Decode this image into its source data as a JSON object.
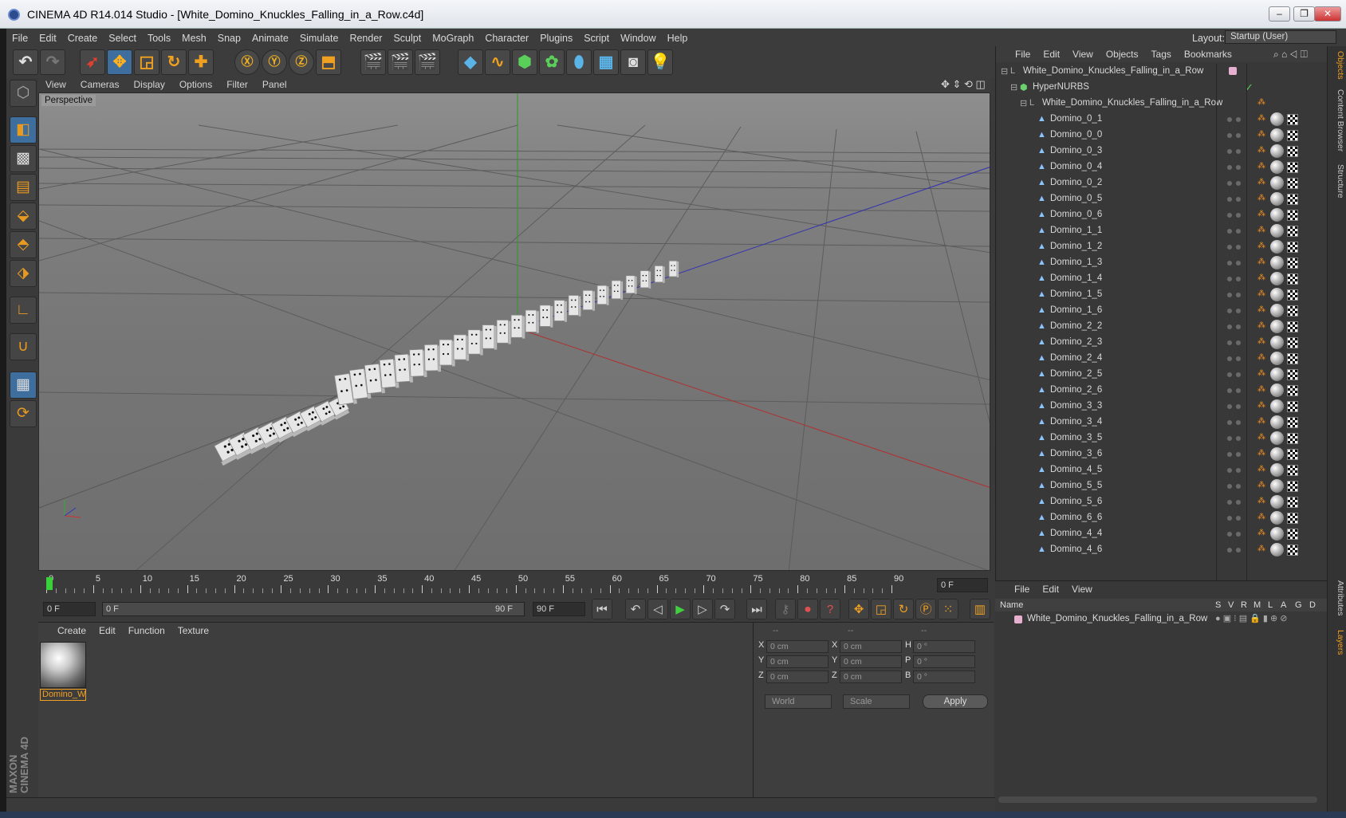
{
  "window": {
    "title": "CINEMA 4D R14.014 Studio - [White_Domino_Knuckles_Falling_in_a_Row.c4d]",
    "min": "–",
    "max": "❐",
    "close": "✕"
  },
  "menu": [
    "File",
    "Edit",
    "Create",
    "Select",
    "Tools",
    "Mesh",
    "Snap",
    "Animate",
    "Simulate",
    "Render",
    "Sculpt",
    "MoGraph",
    "Character",
    "Plugins",
    "Script",
    "Window",
    "Help"
  ],
  "layout": {
    "label": "Layout:",
    "value": "Startup (User)"
  },
  "viewport": {
    "menu": [
      "View",
      "Cameras",
      "Display",
      "Options",
      "Filter",
      "Panel"
    ],
    "label": "Perspective"
  },
  "objects": {
    "menu": [
      "File",
      "Edit",
      "View",
      "Objects",
      "Tags",
      "Bookmarks"
    ],
    "root": "White_Domino_Knuckles_Falling_in_a_Row",
    "hypernurbs": "HyperNURBS",
    "child": "White_Domino_Knuckles_Falling_in_a_Row",
    "items": [
      "Domino_0_1",
      "Domino_0_0",
      "Domino_0_3",
      "Domino_0_4",
      "Domino_0_2",
      "Domino_0_5",
      "Domino_0_6",
      "Domino_1_1",
      "Domino_1_2",
      "Domino_1_3",
      "Domino_1_4",
      "Domino_1_5",
      "Domino_1_6",
      "Domino_2_2",
      "Domino_2_3",
      "Domino_2_4",
      "Domino_2_5",
      "Domino_2_6",
      "Domino_3_3",
      "Domino_3_4",
      "Domino_3_5",
      "Domino_3_6",
      "Domino_4_5",
      "Domino_5_5",
      "Domino_5_6",
      "Domino_6_6",
      "Domino_4_4",
      "Domino_4_6"
    ]
  },
  "right_tabs": [
    "Objects",
    "Content Browser",
    "Structure",
    "Attributes",
    "Layers"
  ],
  "timeline": {
    "labels": [
      "0",
      "5",
      "10",
      "15",
      "20",
      "25",
      "30",
      "35",
      "40",
      "45",
      "50",
      "55",
      "60",
      "65",
      "70",
      "75",
      "80",
      "85",
      "90"
    ],
    "current": "0 F"
  },
  "transport": {
    "start": "0 F",
    "range_start": "0 F",
    "range_end": "90 F",
    "end": "90 F"
  },
  "materials": {
    "menu": [
      "Create",
      "Edit",
      "Function",
      "Texture"
    ],
    "name": "Domino_W"
  },
  "coords": {
    "head": [
      "--",
      "--",
      "--"
    ],
    "rows": [
      {
        "a": "X",
        "av": "0 cm",
        "b": "X",
        "bv": "0 cm",
        "c": "H",
        "cv": "0 °"
      },
      {
        "a": "Y",
        "av": "0 cm",
        "b": "Y",
        "bv": "0 cm",
        "c": "P",
        "cv": "0 °"
      },
      {
        "a": "Z",
        "av": "0 cm",
        "b": "Z",
        "bv": "0 cm",
        "c": "B",
        "cv": "0 °"
      }
    ],
    "world": "World",
    "scale": "Scale",
    "apply": "Apply"
  },
  "layers": {
    "menu": [
      "File",
      "Edit",
      "View"
    ],
    "cols": [
      "Name",
      "S",
      "V",
      "R",
      "M",
      "L",
      "A",
      "G",
      "D"
    ],
    "row": "White_Domino_Knuckles_Falling_in_a_Row"
  },
  "brand": "MAXON CINEMA 4D"
}
